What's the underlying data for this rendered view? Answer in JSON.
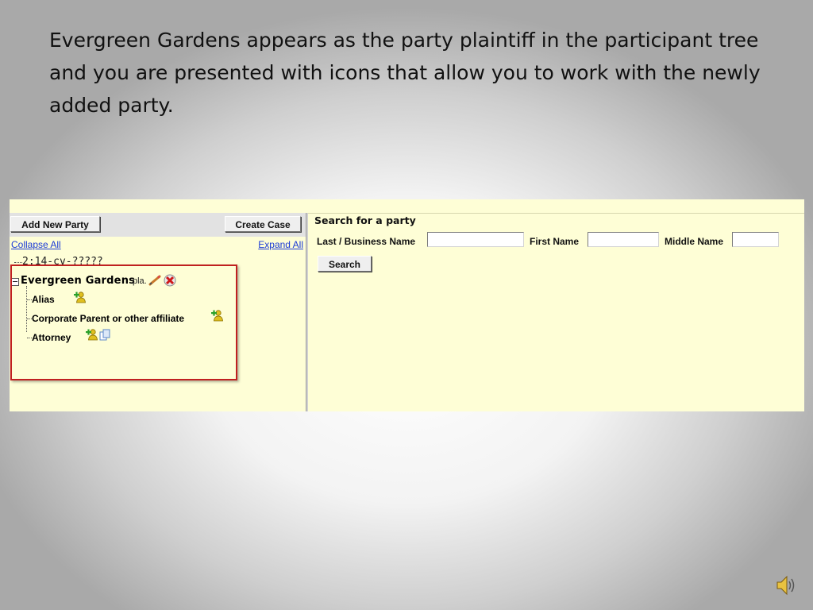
{
  "slide": {
    "text": "Evergreen Gardens appears as the party plaintiff in the participant tree and you are presented with icons that allow you to work with the newly added party."
  },
  "toolbar": {
    "add_new_party_label": "Add New Party",
    "create_case_label": "Create Case"
  },
  "tree_links": {
    "collapse_all": "Collapse All",
    "expand_all": "Expand All"
  },
  "tree": {
    "case_number": "2:14-cv-?????",
    "party_name": "Evergreen Gardens",
    "party_role": "pla.",
    "children": [
      {
        "label": "Alias",
        "icons": [
          "add-person-icon"
        ]
      },
      {
        "label": "Corporate Parent or other affiliate",
        "icons": [
          "add-person-icon"
        ]
      },
      {
        "label": "Attorney",
        "icons": [
          "add-person-icon",
          "copy-icon"
        ]
      }
    ],
    "party_icons": [
      "pencil-icon",
      "delete-icon"
    ]
  },
  "search": {
    "title": "Search for a party",
    "last_name_label": "Last / Business Name",
    "first_name_label": "First Name",
    "middle_name_label": "Middle Name",
    "last_name_value": "",
    "first_name_value": "",
    "middle_name_value": "",
    "search_button_label": "Search"
  },
  "colors": {
    "pane_background": "#fefed6",
    "toolbar_background": "#e2e2e2",
    "link_color": "#1a3ad6",
    "highlight_border": "#c02020"
  },
  "icons": {
    "speaker": "speaker-icon"
  }
}
